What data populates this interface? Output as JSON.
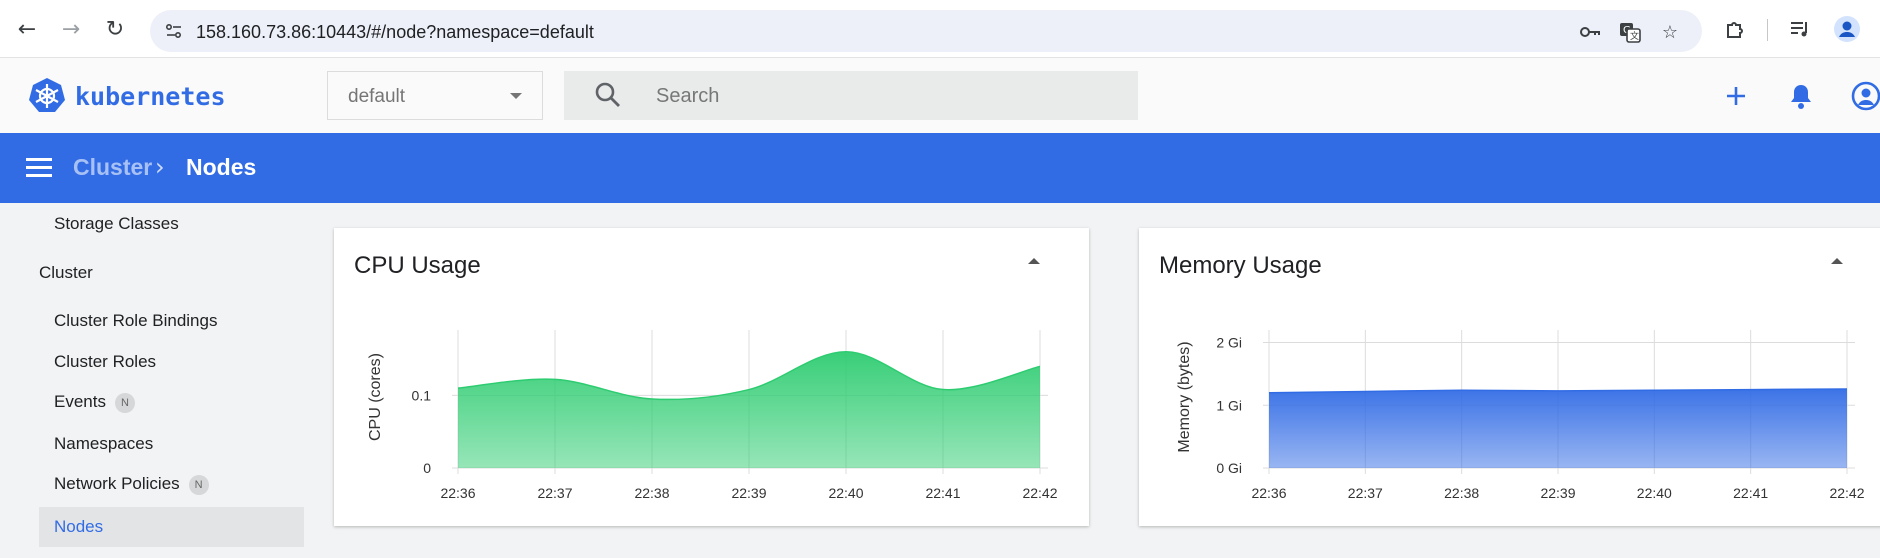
{
  "browser": {
    "url": "158.160.73.86:10443/#/node?namespace=default",
    "icons": [
      "back-icon",
      "forward-icon",
      "reload-icon",
      "site-info-icon",
      "password-key-icon",
      "translate-icon",
      "bookmark-star-icon",
      "extensions-icon",
      "media-queue-icon",
      "profile-icon"
    ]
  },
  "header": {
    "logo_text": "kubernetes",
    "namespace_value": "default",
    "search_placeholder": "Search",
    "icons": [
      "add-icon",
      "notifications-icon",
      "account-icon"
    ]
  },
  "toolbar": {
    "crumb_parent": "Cluster",
    "crumb_separator": "›",
    "crumb_current": "Nodes"
  },
  "sidebar": {
    "storage_classes": "Storage Classes",
    "group_cluster": "Cluster",
    "items": [
      {
        "label": "Cluster Role Bindings",
        "badge": ""
      },
      {
        "label": "Cluster Roles",
        "badge": ""
      },
      {
        "label": "Events",
        "badge": "N"
      },
      {
        "label": "Namespaces",
        "badge": ""
      },
      {
        "label": "Network Policies",
        "badge": "N"
      },
      {
        "label": "Nodes",
        "badge": "",
        "active": true
      }
    ]
  },
  "colors": {
    "brand": "#326ce5",
    "cpu_fill": "#2ecc71",
    "memory_fill": "#326ce5"
  },
  "chart_data": [
    {
      "type": "area",
      "title": "CPU Usage",
      "ylabel": "CPU (cores)",
      "xlabel": "",
      "x": [
        "22:36",
        "22:37",
        "22:38",
        "22:39",
        "22:40",
        "22:41",
        "22:42"
      ],
      "y_ticks": [
        "0",
        "0.1"
      ],
      "ylim": [
        0,
        0.19
      ],
      "series": [
        {
          "values": [
            0.11,
            0.122,
            0.095,
            0.108,
            0.16,
            0.108,
            0.14
          ]
        }
      ],
      "grid": true
    },
    {
      "type": "area",
      "title": "Memory Usage",
      "ylabel": "Memory (bytes)",
      "xlabel": "",
      "x": [
        "22:36",
        "22:37",
        "22:38",
        "22:39",
        "22:40",
        "22:41",
        "22:42"
      ],
      "y_ticks": [
        "0 Gi",
        "1 Gi",
        "2 Gi"
      ],
      "ylim": [
        0,
        2.2
      ],
      "series": [
        {
          "values": [
            1.2,
            1.22,
            1.24,
            1.23,
            1.24,
            1.25,
            1.26
          ]
        }
      ],
      "grid": true
    }
  ]
}
